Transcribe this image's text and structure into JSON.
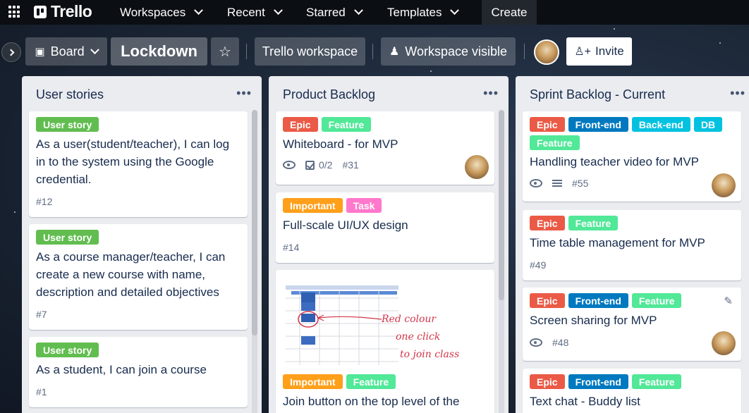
{
  "nav": {
    "logo": "Trello",
    "workspaces": "Workspaces",
    "recent": "Recent",
    "starred": "Starred",
    "templates": "Templates",
    "create": "Create"
  },
  "board_header": {
    "view": "Board",
    "title": "Lockdown",
    "workspace": "Trello workspace",
    "visibility": "Workspace visible",
    "invite": "Invite"
  },
  "lists": [
    {
      "title": "User stories",
      "cards": [
        {
          "labels": [
            "User story"
          ],
          "title": "As a user(student/teacher), I can log in to the system using the Google credential.",
          "number": "#12"
        },
        {
          "labels": [
            "User story"
          ],
          "title": "As a course manager/teacher, I can create a new course with name, description and detailed objectives",
          "number": "#7"
        },
        {
          "labels": [
            "User story"
          ],
          "title": "As a student, I can join a course",
          "number": "#1"
        }
      ]
    },
    {
      "title": "Product Backlog",
      "cards": [
        {
          "labels": [
            "Epic",
            "Feature"
          ],
          "title": "Whiteboard - for MVP",
          "checklist": "0/2",
          "number": "#31"
        },
        {
          "labels": [
            "Important",
            "Task"
          ],
          "title": "Full-scale UI/UX design",
          "number": "#14"
        },
        {
          "cover_text": [
            "Red colour",
            "one click",
            "to join class"
          ],
          "labels": [
            "Important",
            "Feature"
          ],
          "title": "Join button on the top level of the"
        }
      ]
    },
    {
      "title": "Sprint Backlog - Current",
      "cards": [
        {
          "labels": [
            "Epic",
            "Front-end",
            "Back-end",
            "DB",
            "Feature"
          ],
          "title": "Handling teacher video for MVP",
          "number": "#55"
        },
        {
          "labels": [
            "Epic",
            "Feature"
          ],
          "title": "Time table management for MVP",
          "number": "#49"
        },
        {
          "labels": [
            "Epic",
            "Front-end",
            "Feature"
          ],
          "title": "Screen sharing for MVP",
          "number": "#48"
        },
        {
          "labels": [
            "Epic",
            "Front-end",
            "Feature"
          ],
          "title": "Text chat - Buddy list"
        }
      ]
    }
  ],
  "colors": {
    "user_story": "#61bd4f",
    "epic": "#eb5a46",
    "feature": "#51e898",
    "important": "#ff9f1a",
    "task": "#ff78cb",
    "front_end": "#0079bf",
    "back_end": "#00c2e0",
    "db": "#00c2e0"
  },
  "icons": [
    "apps-icon",
    "trello-logo-icon",
    "chevron-down-icon",
    "board-icon",
    "star-icon",
    "people-icon",
    "person-plus-icon",
    "ellipsis-icon",
    "eye-icon",
    "checklist-icon",
    "description-icon",
    "pencil-icon",
    "chevron-right-icon"
  ]
}
